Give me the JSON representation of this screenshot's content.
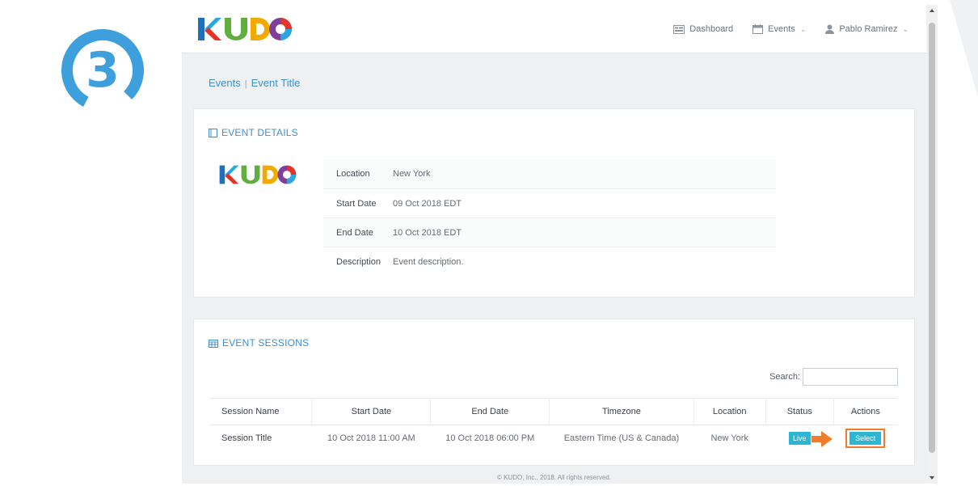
{
  "step": {
    "number": "3"
  },
  "brand": {
    "name": "KUDO",
    "colors": [
      "#1f6fbf",
      "#e6332a",
      "#5fae3e",
      "#f2a900",
      "#7e3f98",
      "#29a8e0"
    ]
  },
  "header": {
    "nav": [
      {
        "icon": "dashboard-icon",
        "label": "Dashboard",
        "has_dropdown": false
      },
      {
        "icon": "calendar-icon",
        "label": "Events",
        "has_dropdown": true
      },
      {
        "icon": "user-icon",
        "label": "Pablo Ramirez",
        "has_dropdown": true
      }
    ]
  },
  "breadcrumb": {
    "root": "Events",
    "current": "Event Title",
    "separator": "|"
  },
  "event_details": {
    "title": "EVENT DETAILS",
    "rows": [
      {
        "label": "Location",
        "value": "New York"
      },
      {
        "label": "Start Date",
        "value": "09 Oct 2018 EDT"
      },
      {
        "label": "End Date",
        "value": "10 Oct 2018 EDT"
      },
      {
        "label": "Description",
        "value": "Event description."
      }
    ]
  },
  "event_sessions": {
    "title": "EVENT SESSIONS",
    "search_label": "Search:",
    "search_value": "",
    "columns": [
      "Session Name",
      "Start Date",
      "End Date",
      "Timezone",
      "Location",
      "Status",
      "Actions"
    ],
    "rows": [
      {
        "name": "Session Title",
        "start": "10 Oct 2018 11:00 AM",
        "end": "10 Oct 2018 06:00 PM",
        "timezone": "Eastern Time (US & Canada)",
        "location": "New York",
        "status": "Live",
        "action": "Select"
      }
    ]
  },
  "footer": {
    "text": "© KUDO, Inc., 2018. All rights reserved."
  },
  "colors": {
    "accent": "#3d8fcf",
    "badge": "#2cb6d1",
    "highlight": "#f07d2f",
    "step": "#3d9fdc"
  }
}
